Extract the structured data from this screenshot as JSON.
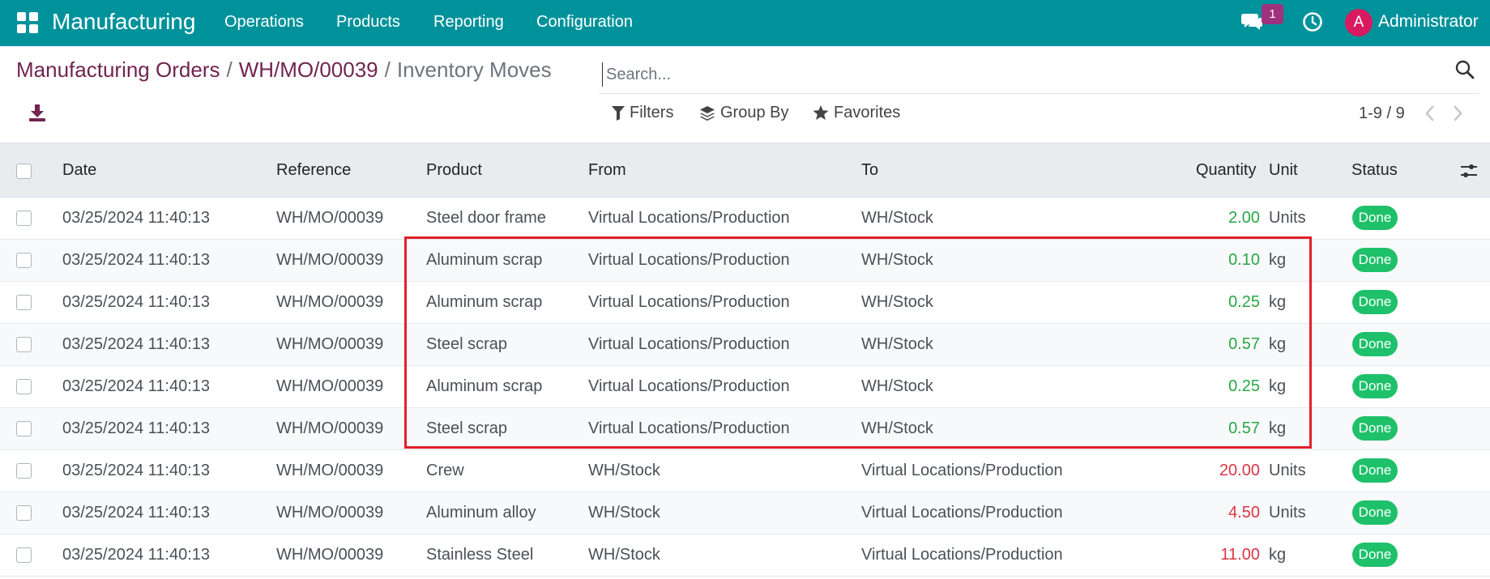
{
  "navbar": {
    "brand": "Manufacturing",
    "menu": [
      "Operations",
      "Products",
      "Reporting",
      "Configuration"
    ],
    "chat_count": "1",
    "avatar_letter": "A",
    "user": "Administrator"
  },
  "breadcrumb": {
    "items": [
      "Manufacturing Orders",
      "WH/MO/00039"
    ],
    "separator": "/",
    "current": "Inventory Moves"
  },
  "search": {
    "placeholder": "Search..."
  },
  "filters": {
    "filters": "Filters",
    "group_by": "Group By",
    "favorites": "Favorites"
  },
  "pager": {
    "value": "1-9 / 9"
  },
  "columns": [
    "Date",
    "Reference",
    "Product",
    "From",
    "To",
    "Quantity",
    "Unit",
    "Status"
  ],
  "rows": [
    {
      "date": "03/25/2024 11:40:13",
      "reference": "WH/MO/00039",
      "product": "Steel door frame",
      "from": "Virtual Locations/Production",
      "to": "WH/Stock",
      "quantity": "2.00",
      "unit": "Units",
      "status": "Done",
      "direction": "in"
    },
    {
      "date": "03/25/2024 11:40:13",
      "reference": "WH/MO/00039",
      "product": "Aluminum scrap",
      "from": "Virtual Locations/Production",
      "to": "WH/Stock",
      "quantity": "0.10",
      "unit": "kg",
      "status": "Done",
      "direction": "in"
    },
    {
      "date": "03/25/2024 11:40:13",
      "reference": "WH/MO/00039",
      "product": "Aluminum scrap",
      "from": "Virtual Locations/Production",
      "to": "WH/Stock",
      "quantity": "0.25",
      "unit": "kg",
      "status": "Done",
      "direction": "in"
    },
    {
      "date": "03/25/2024 11:40:13",
      "reference": "WH/MO/00039",
      "product": "Steel scrap",
      "from": "Virtual Locations/Production",
      "to": "WH/Stock",
      "quantity": "0.57",
      "unit": "kg",
      "status": "Done",
      "direction": "in"
    },
    {
      "date": "03/25/2024 11:40:13",
      "reference": "WH/MO/00039",
      "product": "Aluminum scrap",
      "from": "Virtual Locations/Production",
      "to": "WH/Stock",
      "quantity": "0.25",
      "unit": "kg",
      "status": "Done",
      "direction": "in"
    },
    {
      "date": "03/25/2024 11:40:13",
      "reference": "WH/MO/00039",
      "product": "Steel scrap",
      "from": "Virtual Locations/Production",
      "to": "WH/Stock",
      "quantity": "0.57",
      "unit": "kg",
      "status": "Done",
      "direction": "in"
    },
    {
      "date": "03/25/2024 11:40:13",
      "reference": "WH/MO/00039",
      "product": "Crew",
      "from": "WH/Stock",
      "to": "Virtual Locations/Production",
      "quantity": "20.00",
      "unit": "Units",
      "status": "Done",
      "direction": "out"
    },
    {
      "date": "03/25/2024 11:40:13",
      "reference": "WH/MO/00039",
      "product": "Aluminum alloy",
      "from": "WH/Stock",
      "to": "Virtual Locations/Production",
      "quantity": "4.50",
      "unit": "Units",
      "status": "Done",
      "direction": "out"
    },
    {
      "date": "03/25/2024 11:40:13",
      "reference": "WH/MO/00039",
      "product": "Stainless Steel",
      "from": "WH/Stock",
      "to": "Virtual Locations/Production",
      "quantity": "11.00",
      "unit": "kg",
      "status": "Done",
      "direction": "out"
    }
  ],
  "colors": {
    "navbar": "#00929b",
    "breadcrumb_link": "#71254f",
    "badge": "#1ec16a",
    "qty_in": "#28a745",
    "qty_out": "#dc3545",
    "highlight": "#e0202a"
  }
}
